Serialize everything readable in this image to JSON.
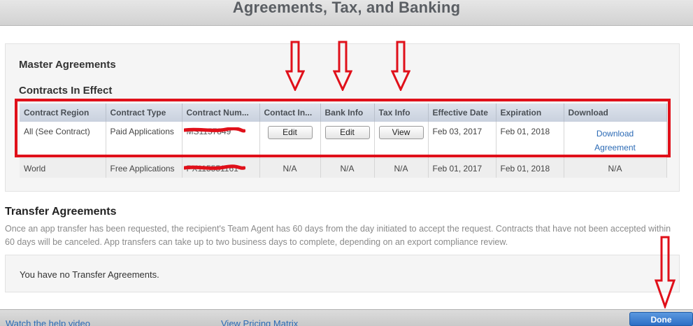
{
  "header": {
    "title": "Agreements, Tax, and Banking"
  },
  "master": {
    "title": "Master Agreements",
    "contracts_title": "Contracts In Effect",
    "columns": [
      "Contract Region",
      "Contract Type",
      "Contract Num...",
      "Contact In...",
      "Bank Info",
      "Tax Info",
      "Effective Date",
      "Expiration",
      "Download"
    ],
    "rows": [
      {
        "region": "All (See Contract)",
        "type": "Paid Applications",
        "number": "MS1157849",
        "contact": "Edit",
        "bank": "Edit",
        "tax": "View",
        "effective": "Feb 03, 2017",
        "expiration": "Feb 01, 2018",
        "download_line1": "Download",
        "download_line2": "Agreement"
      },
      {
        "region": "World",
        "type": "Free Applications",
        "number": "PX115551161",
        "contact": "N/A",
        "bank": "N/A",
        "tax": "N/A",
        "effective": "Feb 01, 2017",
        "expiration": "Feb 01, 2018",
        "download": "N/A"
      }
    ]
  },
  "transfer": {
    "title": "Transfer Agreements",
    "description": "Once an app transfer has been requested, the recipient's Team Agent has 60 days from the day initiated to accept the request. Contracts that have not been accepted within 60 days will be canceled. App transfers can take up to two business days to complete, depending on an export compliance review.",
    "empty_message": "You have no Transfer Agreements."
  },
  "footer": {
    "help_link": "Watch the help video",
    "pricing_link": "View Pricing Matrix",
    "done_label": "Done"
  },
  "colors": {
    "annotation_red": "#e0101a",
    "link_blue": "#2b6ab5",
    "done_blue": "#2c6fc6"
  },
  "icons": {
    "annotation_arrow": "down-arrow-icon",
    "redaction": "scribble-redaction"
  }
}
